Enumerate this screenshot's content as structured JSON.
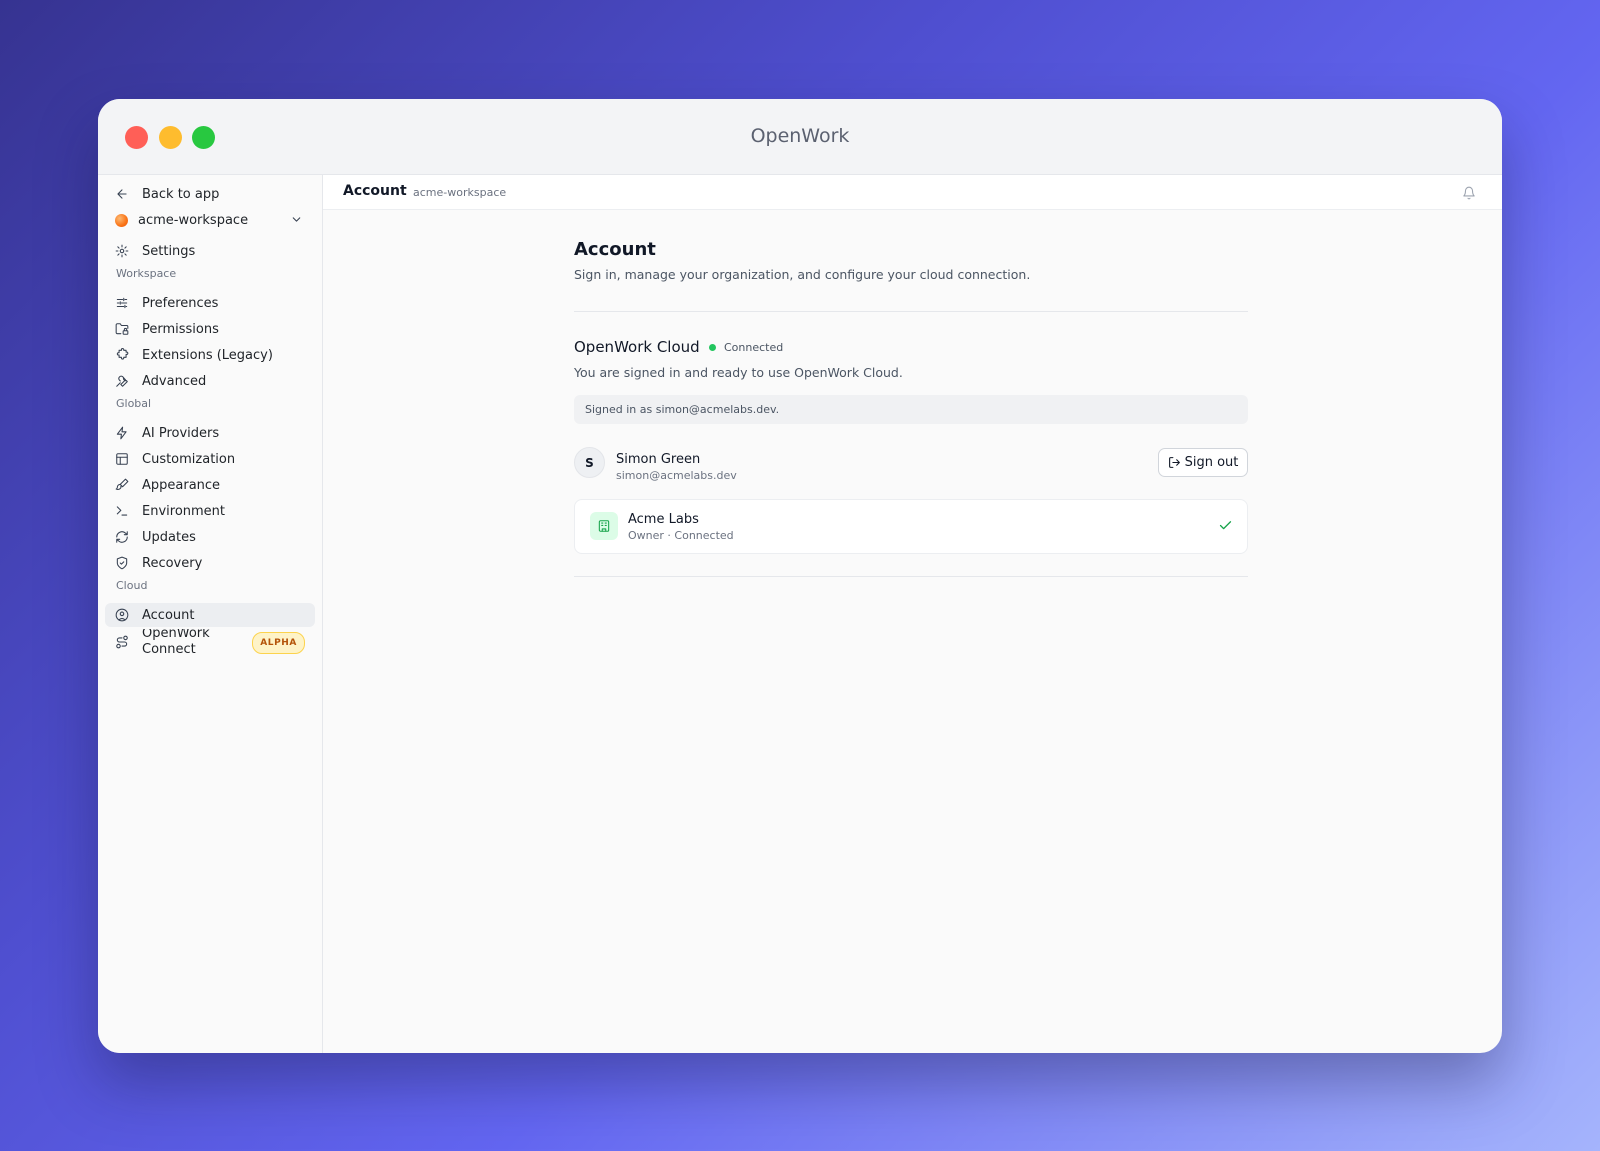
{
  "window": {
    "title": "OpenWork"
  },
  "sidebar": {
    "back_label": "Back to app",
    "workspace_name": "acme-workspace",
    "settings_label": "Settings",
    "sections": {
      "workspace": "Workspace",
      "global": "Global",
      "cloud": "Cloud"
    },
    "items": {
      "preferences": "Preferences",
      "permissions": "Permissions",
      "extensions": "Extensions (Legacy)",
      "advanced": "Advanced",
      "ai_providers": "AI Providers",
      "customization": "Customization",
      "appearance": "Appearance",
      "environment": "Environment",
      "updates": "Updates",
      "recovery": "Recovery",
      "account": "Account",
      "openwork_connect": "OpenWork Connect"
    },
    "active_item": "account",
    "alpha_badge": "ALPHA"
  },
  "topbar": {
    "title": "Account",
    "subtitle": "acme-workspace"
  },
  "page": {
    "heading": "Account",
    "description": "Sign in, manage your organization, and configure your cloud connection."
  },
  "cloud": {
    "title": "OpenWork Cloud",
    "status": "Connected",
    "status_color": "#22c55e",
    "description": "You are signed in and ready to use OpenWork Cloud.",
    "signed_in_notice": "Signed in as simon@acmelabs.dev."
  },
  "user": {
    "initial": "S",
    "name": "Simon Green",
    "email": "simon@acmelabs.dev",
    "sign_out_label": "Sign out"
  },
  "organization": {
    "name": "Acme Labs",
    "meta": "Owner · Connected"
  },
  "icons": {
    "back": "arrow-left-icon",
    "settings": "gear-icon",
    "preferences": "sliders-icon",
    "permissions": "folder-lock-icon",
    "extensions": "puzzle-icon",
    "advanced": "wrench-icon",
    "ai_providers": "zap-icon",
    "customization": "layout-icon",
    "appearance": "paintbrush-icon",
    "environment": "terminal-icon",
    "updates": "refresh-icon",
    "recovery": "shield-icon",
    "account": "user-circle-icon",
    "openwork_connect": "route-icon",
    "notifications": "bell-icon",
    "sign_out": "log-out-icon",
    "organization": "building-icon",
    "selected": "check-icon"
  }
}
